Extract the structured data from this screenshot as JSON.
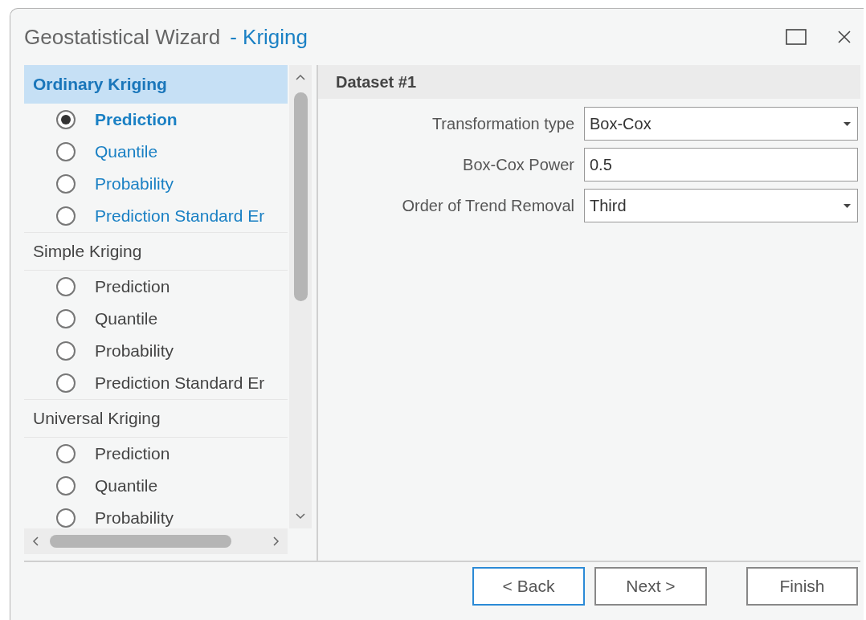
{
  "window": {
    "title": "Geostatistical Wizard",
    "subtitle": "- Kriging"
  },
  "methods": [
    {
      "label": "Ordinary Kriging",
      "selected": true,
      "outputs": [
        {
          "label": "Prediction",
          "selected": true
        },
        {
          "label": "Quantile",
          "selected": false
        },
        {
          "label": "Probability",
          "selected": false
        },
        {
          "label": "Prediction Standard Er",
          "selected": false
        }
      ]
    },
    {
      "label": "Simple Kriging",
      "selected": false,
      "outputs": [
        {
          "label": "Prediction",
          "selected": false
        },
        {
          "label": "Quantile",
          "selected": false
        },
        {
          "label": "Probability",
          "selected": false
        },
        {
          "label": "Prediction Standard Er",
          "selected": false
        }
      ]
    },
    {
      "label": "Universal Kriging",
      "selected": false,
      "outputs": [
        {
          "label": "Prediction",
          "selected": false
        },
        {
          "label": "Quantile",
          "selected": false
        },
        {
          "label": "Probability",
          "selected": false
        }
      ]
    }
  ],
  "panel": {
    "title": "Dataset #1",
    "fields": [
      {
        "label": "Transformation type",
        "kind": "dropdown",
        "value": "Box-Cox"
      },
      {
        "label": "Box-Cox Power",
        "kind": "text",
        "value": "0.5"
      },
      {
        "label": "Order of Trend Removal",
        "kind": "dropdown",
        "value": "Third"
      }
    ]
  },
  "buttons": [
    {
      "label": "< Back",
      "focused": true
    },
    {
      "label": "Next >",
      "focused": false
    },
    {
      "label": "Finish",
      "focused": false
    }
  ]
}
